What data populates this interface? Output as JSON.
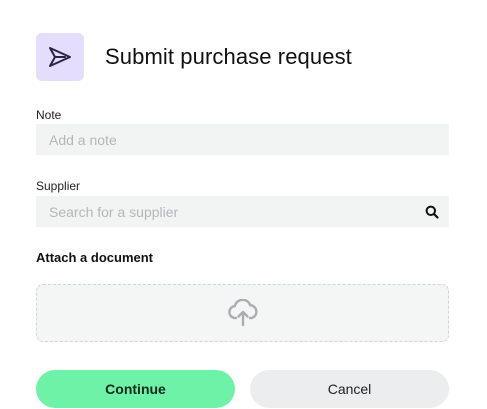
{
  "dialog": {
    "title": "Submit purchase request"
  },
  "note": {
    "label": "Note",
    "placeholder": "Add a note",
    "value": ""
  },
  "supplier": {
    "label": "Supplier",
    "placeholder": "Search for a supplier",
    "value": ""
  },
  "attachment": {
    "section_title": "Attach a document"
  },
  "actions": {
    "continue_label": "Continue",
    "cancel_label": "Cancel"
  },
  "icons": {
    "header": "send-icon",
    "search": "search-icon",
    "upload": "cloud-upload-icon"
  },
  "colors": {
    "icon_tile": "#E4DEFC",
    "input_bg": "#F2F3F3",
    "primary_button": "#6EF2A7",
    "secondary_button": "#ECEDEE"
  }
}
